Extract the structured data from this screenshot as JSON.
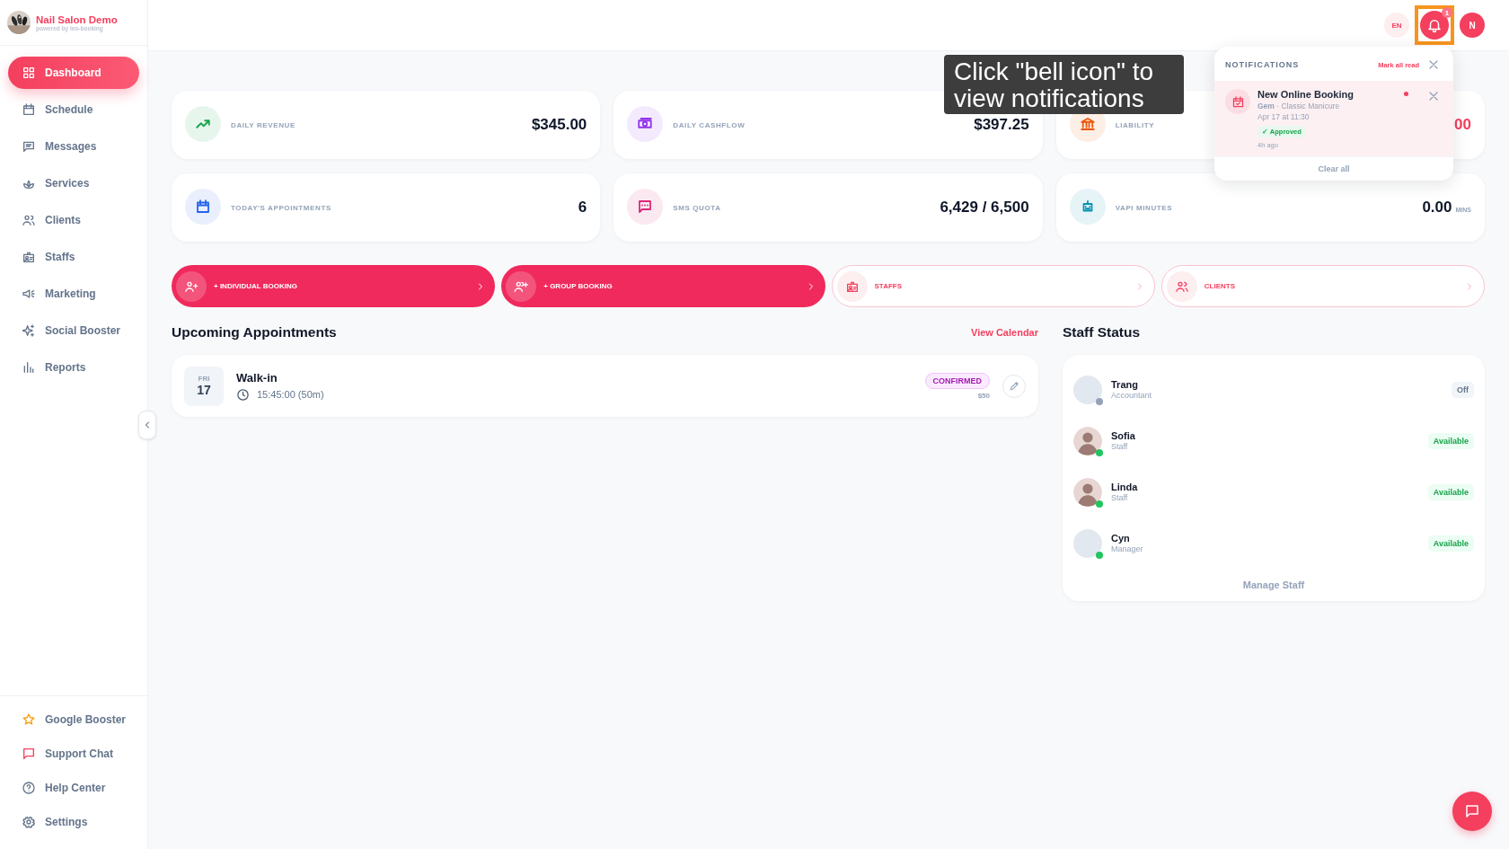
{
  "brand": {
    "name": "Nail Salon Demo",
    "tagline": "powered by leo-booking"
  },
  "nav": [
    {
      "label": "Dashboard",
      "selected": true
    },
    {
      "label": "Schedule",
      "selected": false
    },
    {
      "label": "Messages",
      "selected": false
    },
    {
      "label": "Services",
      "selected": false
    },
    {
      "label": "Clients",
      "selected": false
    },
    {
      "label": "Staffs",
      "selected": false
    },
    {
      "label": "Marketing",
      "selected": false
    },
    {
      "label": "Social Booster",
      "selected": false
    },
    {
      "label": "Reports",
      "selected": false
    }
  ],
  "footer_nav": [
    {
      "label": "Google Booster",
      "color": "#f59e0b"
    },
    {
      "label": "Support Chat",
      "color": "#f43f5e"
    },
    {
      "label": "Help Center",
      "color": "#64748b"
    },
    {
      "label": "Settings",
      "color": "#64748b"
    }
  ],
  "header": {
    "language": "EN",
    "notification_count": "1",
    "user_initial": "N"
  },
  "tooltip": "Click \"bell icon\" to view notifications",
  "notifications": {
    "title": "NOTIFICATIONS",
    "mark_all": "Mark all read",
    "clear": "Clear all",
    "items": [
      {
        "title": "New Online Booking",
        "detail": "**Gem** · Classic Manicure",
        "time": "Apr 17 at 11:30",
        "status": "✓ Approved",
        "age": "4h ago",
        "unread": true
      }
    ]
  },
  "stats": [
    {
      "label": "DAILY REVENUE",
      "value": "$345.00",
      "color": "#16a34a",
      "kind": "plain"
    },
    {
      "label": "DAILY CASHFLOW",
      "value": "$397.25",
      "color": "#9333ea",
      "kind": "plain"
    },
    {
      "label": "LIABILITY",
      "value": "00",
      "color": "#ea580c",
      "kind": "alert"
    },
    {
      "label": "TODAY'S APPOINTMENTS",
      "value": "6",
      "color": "#2563eb",
      "kind": "plain"
    },
    {
      "label": "SMS QUOTA",
      "value": "6,429 / 6,500",
      "color": "#db2777",
      "kind": "plain"
    },
    {
      "label": "VAPI MINUTES",
      "value": "0.00",
      "unit": "MINS",
      "color": "#0891b2",
      "kind": "plain"
    }
  ],
  "actions": [
    {
      "label": "+ INDIVIDUAL BOOKING",
      "kind": "primary"
    },
    {
      "label": "+ GROUP BOOKING",
      "kind": "primary"
    },
    {
      "label": "STAFFS",
      "kind": "outline"
    },
    {
      "label": "CLIENTS",
      "kind": "outline"
    }
  ],
  "appointments": {
    "title": "Upcoming Appointments",
    "link": "View Calendar",
    "items": [
      {
        "day": "FRI",
        "date": "17",
        "name": "Walk-in",
        "time": "15:45:00 (50m)",
        "status": "CONFIRMED",
        "price": "$50"
      }
    ]
  },
  "staff": {
    "title": "Staff Status",
    "manage": "Manage Staff",
    "items": [
      {
        "name": "Trang",
        "role": "Accountant",
        "status": "Off",
        "online": false,
        "photo": false
      },
      {
        "name": "Sofia",
        "role": "Staff",
        "status": "Available",
        "online": true,
        "photo": true
      },
      {
        "name": "Linda",
        "role": "Staff",
        "status": "Available",
        "online": true,
        "photo": true
      },
      {
        "name": "Cyn",
        "role": "Manager",
        "status": "Available",
        "online": true,
        "photo": false
      }
    ]
  }
}
